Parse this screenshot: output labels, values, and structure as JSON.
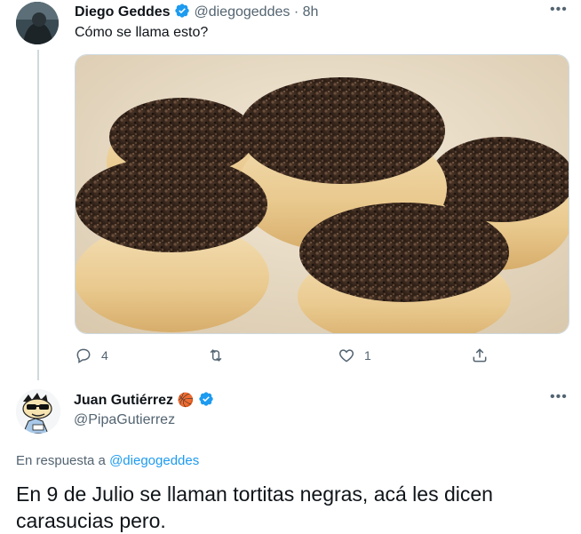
{
  "tweet": {
    "author_name": "Diego Geddes",
    "handle": "@diegogeddes",
    "separator": "·",
    "time": "8h",
    "more_label": "•••",
    "text": "Cómo se llama esto?",
    "actions": {
      "reply_count": "4",
      "retweet_count": "",
      "like_count": "1"
    }
  },
  "reply": {
    "author_name": "Juan Gutiérrez",
    "author_emoji": "🏀",
    "handle": "@PipaGutierrez",
    "more_label": "•••",
    "in_reply_prefix": "En respuesta a",
    "in_reply_handle": "@diegogeddes",
    "text": "En 9 de Julio se llaman tortitas negras, acá les dicen carasucias pero."
  },
  "colors": {
    "verified": "#1d9bf0",
    "muted": "#536471",
    "link": "#1d9bf0",
    "thread_line": "#cfd9de"
  }
}
